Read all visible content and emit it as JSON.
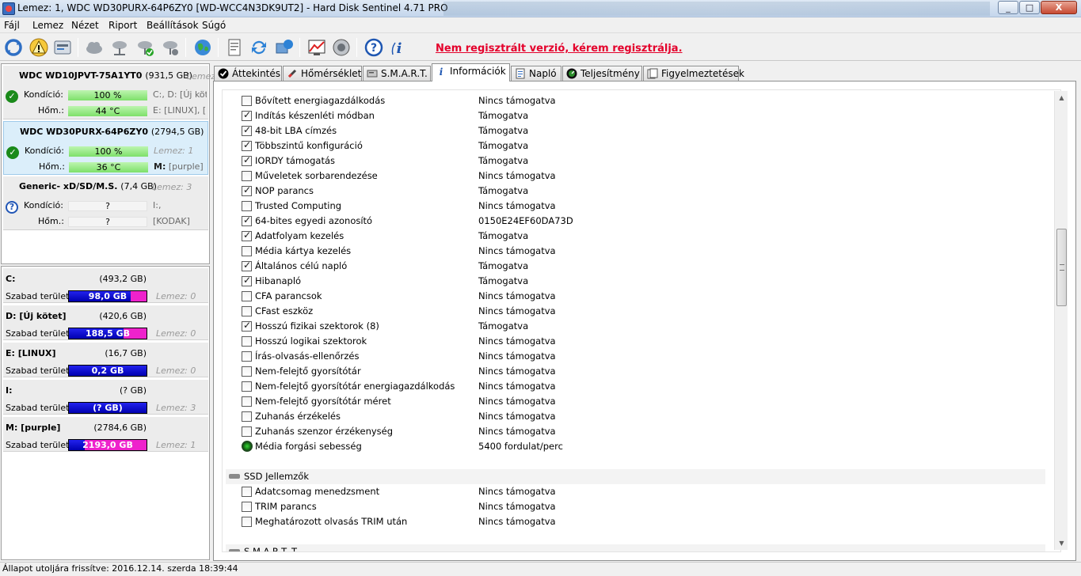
{
  "window": {
    "title": "Lemez: 1, WDC WD30PURX-64P6ZY0 [WD-WCC4N3DK9UT2]  -  Hard Disk Sentinel 4.71 PRO",
    "min_symbol": "_",
    "max_symbol": "□",
    "close_symbol": "X"
  },
  "menu": [
    {
      "label": "Fájl"
    },
    {
      "label": "Lemez"
    },
    {
      "label": "Nézet"
    },
    {
      "label": "Riport"
    },
    {
      "label": "Beállítások"
    },
    {
      "label": "Súgó"
    }
  ],
  "toolbar": {
    "register_notice": "Nem regisztrált verzió, kérem regisztrálja.",
    "icons": [
      "refresh-icon",
      "warning-icon",
      "disk-report-icon",
      "cloud-icon",
      "network-disk-icon",
      "network-ok-icon",
      "network-settings-icon",
      "globe-icon",
      "document-icon",
      "sync-icon",
      "send-icon",
      "chart-icon",
      "speaker-icon",
      "help-icon",
      "info-icon"
    ]
  },
  "disks": [
    {
      "name": "WDC WD10JPVT-75A1YT0",
      "size": "(931,5 GB)",
      "lemez": "Lemez",
      "status": "ok",
      "kondicio_label": "Kondíció:",
      "kondicio": "100 %",
      "kondicio_level": 1.0,
      "hom_label": "Hőm.:",
      "hom": "44 °C",
      "info1": "C:, D: [Új kötet]",
      "info2": "E: [LINUX], [R"
    },
    {
      "name": "WDC WD30PURX-64P6ZY0",
      "size": "(2794,5 GB)",
      "lemez": "",
      "status": "ok",
      "kondicio_label": "Kondíció:",
      "kondicio": "100 %",
      "kondicio_level": 1.0,
      "hom_label": "Hőm.:",
      "hom": "36 °C",
      "info1": "Lemez: 1",
      "info2_bold": "M:",
      "info2": " [purple]"
    },
    {
      "name": "Generic- xD/SD/M.S.",
      "size": "(7,4 GB)",
      "lemez": "Lemez: 3",
      "status": "unknown",
      "kondicio_label": "Kondíció:",
      "kondicio": "?",
      "hom_label": "Hőm.:",
      "hom": "?",
      "info1": "I:,",
      "info2": "[KODAK]"
    }
  ],
  "partitions": [
    {
      "name": "C:",
      "size": "(493,2 GB)",
      "free_label": "Szabad terület",
      "free": "98,0 GB",
      "free_fraction": 0.8,
      "lemez": "Lemez: 0"
    },
    {
      "name": "D: [Új kötet]",
      "size": "(420,6 GB)",
      "free_label": "Szabad terület",
      "free": "188,5 GB",
      "free_fraction": 0.7,
      "lemez": "Lemez: 0"
    },
    {
      "name": "E: [LINUX]",
      "size": "(16,7 GB)",
      "free_label": "Szabad terület",
      "free": "0,2 GB",
      "free_fraction": 1.0,
      "lemez": "Lemez: 0"
    },
    {
      "name": "I:",
      "size": "(? GB)",
      "free_label": "Szabad terület",
      "free": "(? GB)",
      "free_fraction": 1.0,
      "lemez": "Lemez: 3"
    },
    {
      "name": "M: [purple]",
      "size": "(2784,6 GB)",
      "free_label": "Szabad terület",
      "free": "2193,0 GB",
      "free_fraction": 0.2,
      "lemez": "Lemez: 1"
    }
  ],
  "tabs": [
    {
      "label": "Áttekintés",
      "icon": "check-icon",
      "active": false
    },
    {
      "label": "Hőmérséklet",
      "icon": "thermometer-icon",
      "active": false
    },
    {
      "label": "S.M.A.R.T.",
      "icon": "smart-icon",
      "active": false
    },
    {
      "label": "Információk",
      "icon": "info-icon",
      "active": true
    },
    {
      "label": "Napló",
      "icon": "log-icon",
      "active": false
    },
    {
      "label": "Teljesítmény",
      "icon": "performance-icon",
      "active": false
    },
    {
      "label": "Figyelmeztetések",
      "icon": "alerts-icon",
      "active": false
    }
  ],
  "features": [
    {
      "name": "Bővített energiagazdálkodás",
      "value": "Nincs támogatva",
      "checked": false
    },
    {
      "name": "Indítás készenléti módban",
      "value": "Támogatva",
      "checked": true
    },
    {
      "name": "48-bit LBA címzés",
      "value": "Támogatva",
      "checked": true
    },
    {
      "name": "Többszintű konfiguráció",
      "value": "Támogatva",
      "checked": true
    },
    {
      "name": "IORDY támogatás",
      "value": "Támogatva",
      "checked": true
    },
    {
      "name": "Műveletek sorbarendezése",
      "value": "Nincs támogatva",
      "checked": false
    },
    {
      "name": "NOP parancs",
      "value": "Támogatva",
      "checked": true
    },
    {
      "name": "Trusted Computing",
      "value": "Nincs támogatva",
      "checked": false
    },
    {
      "name": "64-bites egyedi azonosító",
      "value": "0150E24EF60DA73D",
      "checked": true
    },
    {
      "name": "Adatfolyam kezelés",
      "value": "Támogatva",
      "checked": true
    },
    {
      "name": "Média kártya kezelés",
      "value": "Nincs támogatva",
      "checked": false
    },
    {
      "name": "Általános célú napló",
      "value": "Támogatva",
      "checked": true
    },
    {
      "name": "Hibanapló",
      "value": "Támogatva",
      "checked": true
    },
    {
      "name": "CFA parancsok",
      "value": "Nincs támogatva",
      "checked": false
    },
    {
      "name": "CFast eszköz",
      "value": "Nincs támogatva",
      "checked": false
    },
    {
      "name": "Hosszú fizikai szektorok (8)",
      "value": "Támogatva",
      "checked": true
    },
    {
      "name": "Hosszú logikai szektorok",
      "value": "Nincs támogatva",
      "checked": false
    },
    {
      "name": "Írás-olvasás-ellenőrzés",
      "value": "Nincs támogatva",
      "checked": false
    },
    {
      "name": "Nem-felejtő gyorsítótár",
      "value": "Nincs támogatva",
      "checked": false
    },
    {
      "name": "Nem-felejtő gyorsítótár energiagazdálkodás",
      "value": "Nincs támogatva",
      "checked": false
    },
    {
      "name": "Nem-felejtő gyorsítótár méret",
      "value": "Nincs támogatva",
      "checked": false
    },
    {
      "name": "Zuhanás érzékelés",
      "value": "Nincs támogatva",
      "checked": false
    },
    {
      "name": "Zuhanás szenzor érzékenység",
      "value": "Nincs támogatva",
      "checked": false
    },
    {
      "name": "Média forgási sebesség",
      "value": "5400 fordulat/perc",
      "checked": null
    }
  ],
  "ssd_section": {
    "title": "SSD Jellemzők",
    "features": [
      {
        "name": "Adatcsomag menedzsment",
        "value": "Nincs támogatva",
        "checked": false
      },
      {
        "name": "TRIM parancs",
        "value": "Nincs támogatva",
        "checked": false
      },
      {
        "name": "Meghatározott olvasás TRIM után",
        "value": "Nincs támogatva",
        "checked": false
      }
    ]
  },
  "next_section": {
    "title": "S.M.A.R.T. T..."
  },
  "scroll": {
    "position": 0.35
  },
  "status": {
    "text": "Állapot utoljára frissítve: 2016.12.14. szerda 18:39:44"
  }
}
